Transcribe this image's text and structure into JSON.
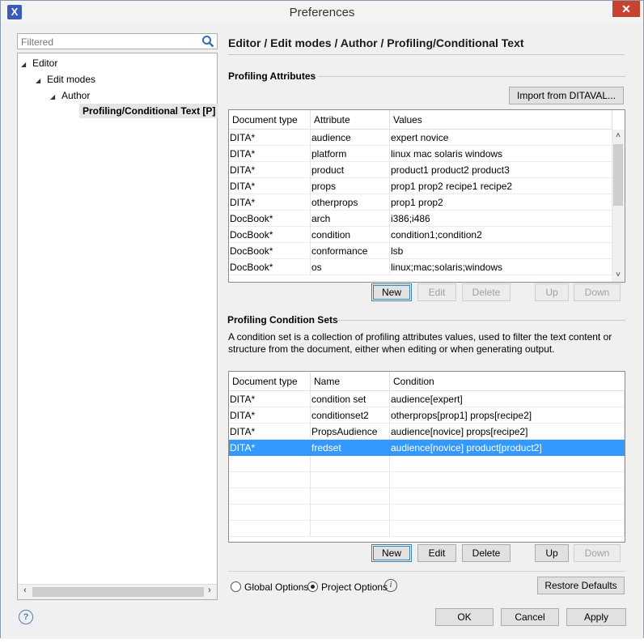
{
  "window": {
    "title": "Preferences",
    "close_symbol": "✕",
    "app_icon_letter": "X"
  },
  "sidebar": {
    "filter_placeholder": "Filtered",
    "tree": [
      {
        "label": "Editor",
        "arrow": "◢",
        "selected": false
      },
      {
        "label": "Edit modes",
        "arrow": "◢",
        "selected": false
      },
      {
        "label": "Author",
        "arrow": "◢",
        "selected": false
      },
      {
        "label": "Profiling/Conditional Text [P]",
        "arrow": "",
        "selected": true
      }
    ]
  },
  "page": {
    "title": "Editor / Edit modes / Author / Profiling/Conditional Text"
  },
  "attributes": {
    "section_title": "Profiling Attributes",
    "import_button": "Import from DITAVAL...",
    "columns": [
      "Document type",
      "Attribute",
      "Values"
    ],
    "rows": [
      [
        "DITA*",
        "audience",
        "expert novice"
      ],
      [
        "DITA*",
        "platform",
        "linux mac solaris windows"
      ],
      [
        "DITA*",
        "product",
        "product1 product2 product3"
      ],
      [
        "DITA*",
        "props",
        "prop1 prop2 recipe1 recipe2"
      ],
      [
        "DITA*",
        "otherprops",
        "prop1 prop2"
      ],
      [
        "DocBook*",
        "arch",
        "i386;i486"
      ],
      [
        "DocBook*",
        "condition",
        "condition1;condition2"
      ],
      [
        "DocBook*",
        "conformance",
        "lsb"
      ],
      [
        "DocBook*",
        "os",
        "linux;mac;solaris;windows"
      ]
    ],
    "buttons": {
      "new": "New",
      "edit": "Edit",
      "delete": "Delete",
      "up": "Up",
      "down": "Down"
    }
  },
  "condition_sets": {
    "section_title": "Profiling Condition Sets",
    "description": "A condition set is a collection of profiling attributes values, used to filter the text content or structure from the document, either when editing or when generating output.",
    "columns": [
      "Document type",
      "Name",
      "Condition"
    ],
    "rows": [
      [
        "DITA*",
        "condition set",
        "audience[expert]"
      ],
      [
        "DITA*",
        "conditionset2",
        "otherprops[prop1] props[recipe2]"
      ],
      [
        "DITA*",
        "PropsAudience",
        "audience[novice] props[recipe2]"
      ],
      [
        "DITA*",
        "fredset",
        "audience[novice] product[product2]"
      ]
    ],
    "selected_row": 3,
    "buttons": {
      "new": "New",
      "edit": "Edit",
      "delete": "Delete",
      "up": "Up",
      "down": "Down"
    }
  },
  "options": {
    "global": "Global Options",
    "project": "Project Options",
    "selected": "project",
    "restore_defaults": "Restore Defaults"
  },
  "footer": {
    "ok": "OK",
    "cancel": "Cancel",
    "apply": "Apply"
  },
  "colors": {
    "selection": "#3399ff",
    "close_button": "#c7432f"
  }
}
